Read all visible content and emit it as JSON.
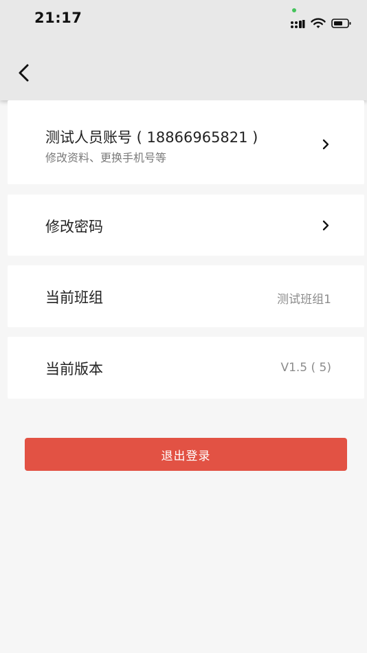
{
  "status_bar": {
    "time": "21:17"
  },
  "nav": {
    "back_icon": "chevron-left-icon"
  },
  "account": {
    "title": "测试人员账号 ( 18866965821 )",
    "subtitle": "修改资料、更换手机号等"
  },
  "password": {
    "title": "修改密码"
  },
  "team": {
    "title": "当前班组",
    "value": "测试班组1"
  },
  "version": {
    "title": "当前版本",
    "value": "V1.5 ( 5)"
  },
  "logout": {
    "label": "退出登录"
  },
  "colors": {
    "accent": "#e25244",
    "status_dot": "#44c35b"
  }
}
